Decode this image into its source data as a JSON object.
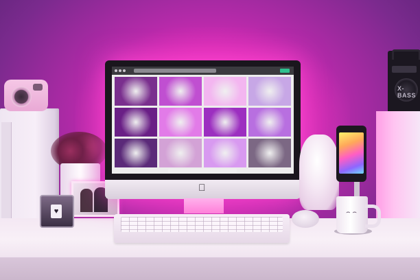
{
  "scene": {
    "description_tags": [
      "desk",
      "imac",
      "pink-lighting"
    ]
  },
  "speaker": {
    "brand_text": "X-BASS"
  },
  "imac": {
    "logo_glyph": ""
  },
  "candle": {
    "label_glyph": "♥"
  },
  "mug": {
    "face_text": "⌢ ⌢"
  },
  "screen_tiles": [
    {
      "color": "#7a2f8e"
    },
    {
      "color": "#c04fd1"
    },
    {
      "color": "#f3b6f0"
    },
    {
      "color": "#c7a7e6"
    },
    {
      "color": "#6a1f86"
    },
    {
      "color": "#e27be8"
    },
    {
      "color": "#9c2fc0"
    },
    {
      "color": "#b86fe0"
    },
    {
      "color": "#5b2a79"
    },
    {
      "color": "#d3a2d6"
    },
    {
      "color": "#d89af0"
    },
    {
      "color": "#7c6884"
    }
  ],
  "colors": {
    "wall_accent": "#ff2ec8",
    "desk": "#f4e8f3"
  }
}
